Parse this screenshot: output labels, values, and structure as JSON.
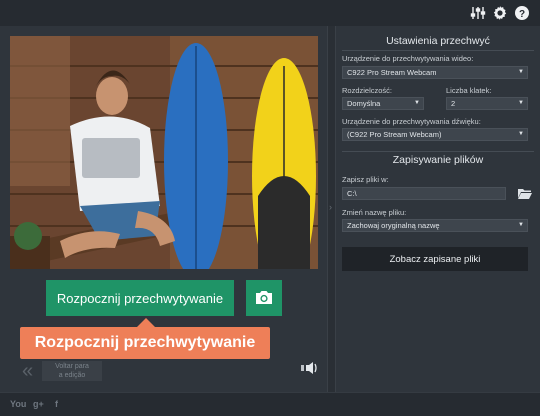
{
  "toolbar": {
    "icons": [
      "equalizer-icon",
      "gear-icon",
      "help-icon"
    ]
  },
  "main": {
    "start_button_label": "Rozpocznij przechwytywanie",
    "snapshot_icon": "camera-icon",
    "tooltip_text": "Rozpocznij przechwytywanie",
    "back_label_line1": "Voltar para",
    "back_label_line2": "a edição",
    "speaker_icon": "speaker-icon"
  },
  "settings": {
    "capture_title": "Ustawienia przechwyć",
    "video_device_label": "Urządzenie do przechwytywania wideo:",
    "video_device_value": "C922 Pro Stream Webcam",
    "resolution_label": "Rozdzielczość:",
    "resolution_value": "Domyślna",
    "frame_rate_label": "Liczba klatek:",
    "frame_rate_value": "2",
    "audio_device_label": "Urządzenie do przechwytywania dźwięku:",
    "audio_device_value": "(C922 Pro Stream Webcam)",
    "saving_title": "Zapisywanie plików",
    "save_to_label": "Zapisz pliki w:",
    "save_to_value": "C:\\",
    "rename_label": "Zmień nazwę pliku:",
    "rename_value": "Zachowaj oryginalną nazwę",
    "view_saved_button": "Zobacz zapisane pliki"
  },
  "footer": {
    "youtube_label": "You",
    "gplus_label": "g+",
    "facebook_label": "f"
  },
  "colors": {
    "accent_green": "#1f9467",
    "tooltip_orange": "#ee7f58",
    "panel_bg": "#2f353c",
    "app_bg": "#23282e"
  }
}
